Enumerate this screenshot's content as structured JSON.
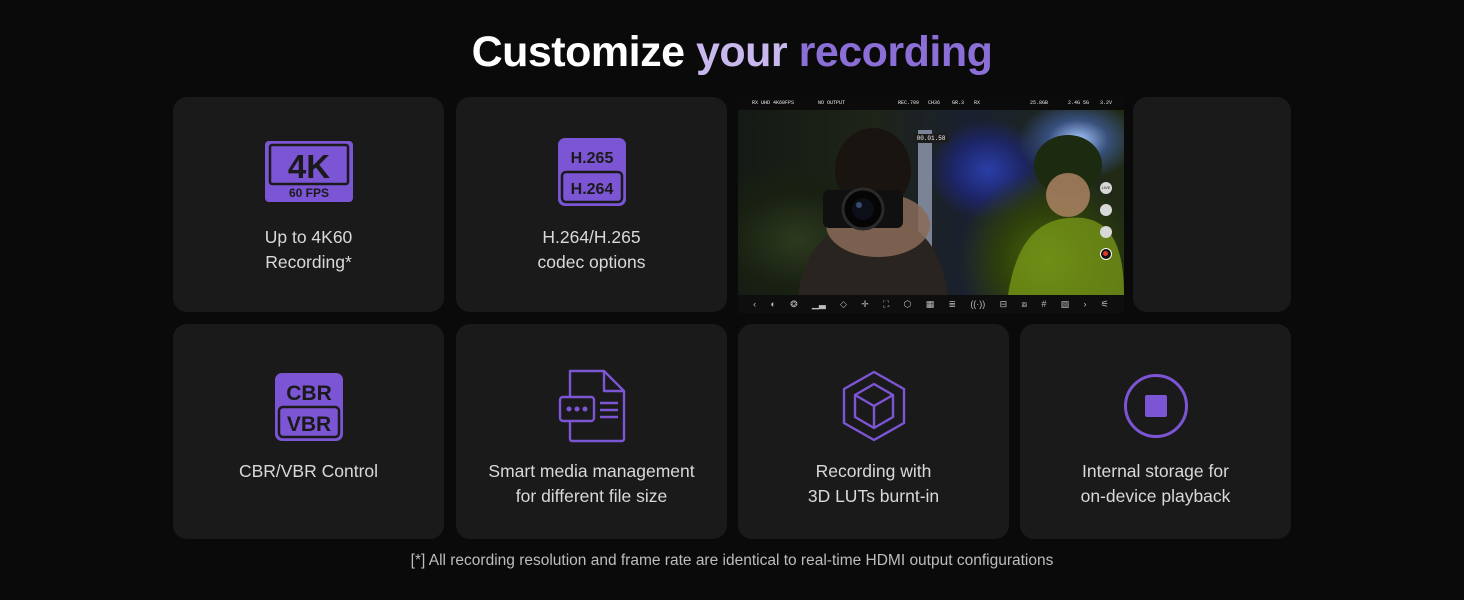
{
  "title": {
    "part1": "Customize ",
    "part2": "your ",
    "part3": "recording"
  },
  "cards": [
    {
      "icon": "4k-60fps-icon",
      "badge_top": "4K",
      "badge_bottom": "60 FPS",
      "label": "Up to 4K60\nRecording*"
    },
    {
      "icon": "codec-h265-h264-icon",
      "badge_top": "H.265",
      "badge_bottom": "H.264",
      "label": "H.264/H.265\ncodec options"
    },
    {
      "icon": "cbr-vbr-icon",
      "badge_top": "CBR",
      "badge_bottom": "VBR",
      "label": "CBR/VBR Control"
    },
    {
      "icon": "media-file-icon",
      "label": "Smart media management\nfor different file size"
    },
    {
      "icon": "3d-cube-icon",
      "label": "Recording with\n3D LUTs burnt-in"
    },
    {
      "icon": "stop-button-icon",
      "label": "Internal storage for\non-device playback"
    }
  ],
  "monitor": {
    "top_bar": {
      "rx": "RX UHD 4K60FPS",
      "output": "NO OUTPUT",
      "rec": "REC.709",
      "ch": "CH36",
      "gr": "GR.3",
      "rx2": "RX",
      "storage": "25.8GB",
      "signal": "2.4G 5G",
      "battery": "3.2V"
    },
    "timecode": "00.01.58",
    "side_buttons": [
      "LIVE",
      "",
      "",
      ""
    ]
  },
  "footnote": "[*] All recording resolution and frame rate are identical to real-time HDMI output configurations",
  "colors": {
    "accent": "#7c55d4",
    "accent_light": "#c9b8ee",
    "card_bg": "#1a1a1a",
    "page_bg": "#0a0a0a"
  }
}
